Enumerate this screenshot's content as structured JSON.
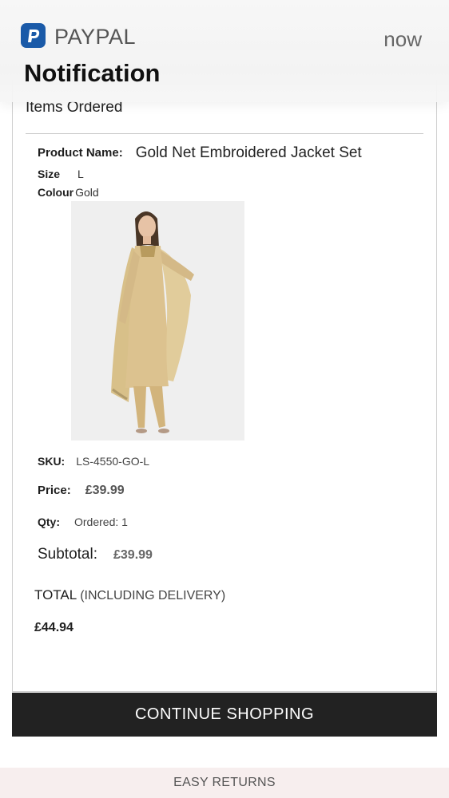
{
  "notification": {
    "app_name": "PAYPAL",
    "time": "now",
    "title": "Notification",
    "icon": "paypal-icon"
  },
  "order": {
    "items_heading": "Items Ordered",
    "product_name_label": "Product Name:",
    "product_name": "Gold Net Embroidered Jacket Set",
    "size_label": "Size",
    "size": "L",
    "colour_label": "Colour",
    "colour": "Gold",
    "sku_label": "SKU:",
    "sku": "LS-4550-GO-L",
    "price_label": "Price:",
    "price": "£39.99",
    "qty_label": "Qty:",
    "qty": "Ordered: 1",
    "subtotal_label": "Subtotal:",
    "subtotal": "£39.99",
    "total_label": "TOTAL",
    "total_note": "(INCLUDING DELIVERY)",
    "total": "£44.94"
  },
  "actions": {
    "continue_label": "CONTINUE SHOPPING"
  },
  "footer": {
    "returns_label": "EASY RETURNS"
  },
  "colors": {
    "button_bg": "#222222",
    "returns_bg": "#f7eeee",
    "product_gold": "#d9c08f",
    "paypal_blue": "#1a5aa8"
  }
}
